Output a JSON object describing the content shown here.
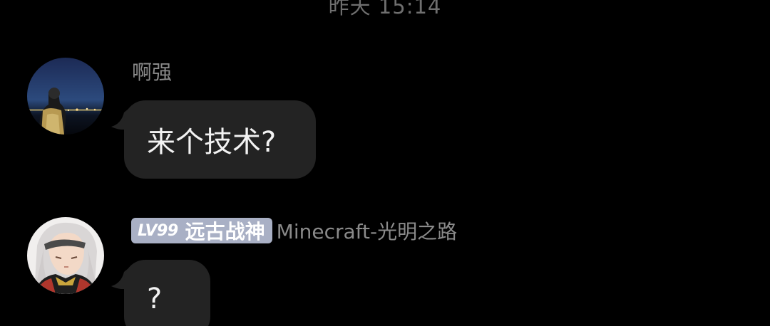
{
  "chat": {
    "timestamp": "昨天 15:14",
    "messages": [
      {
        "sender": "啊强",
        "text": "来个技术?"
      },
      {
        "badge_level": "LV99",
        "badge_title": "远古战神",
        "group_title": "Minecraft-光明之路",
        "text": "?"
      }
    ]
  },
  "colors": {
    "background": "#000000",
    "bubble": "#232323",
    "badge": "#a9b0c5",
    "secondary_text": "#8a8a8a"
  }
}
